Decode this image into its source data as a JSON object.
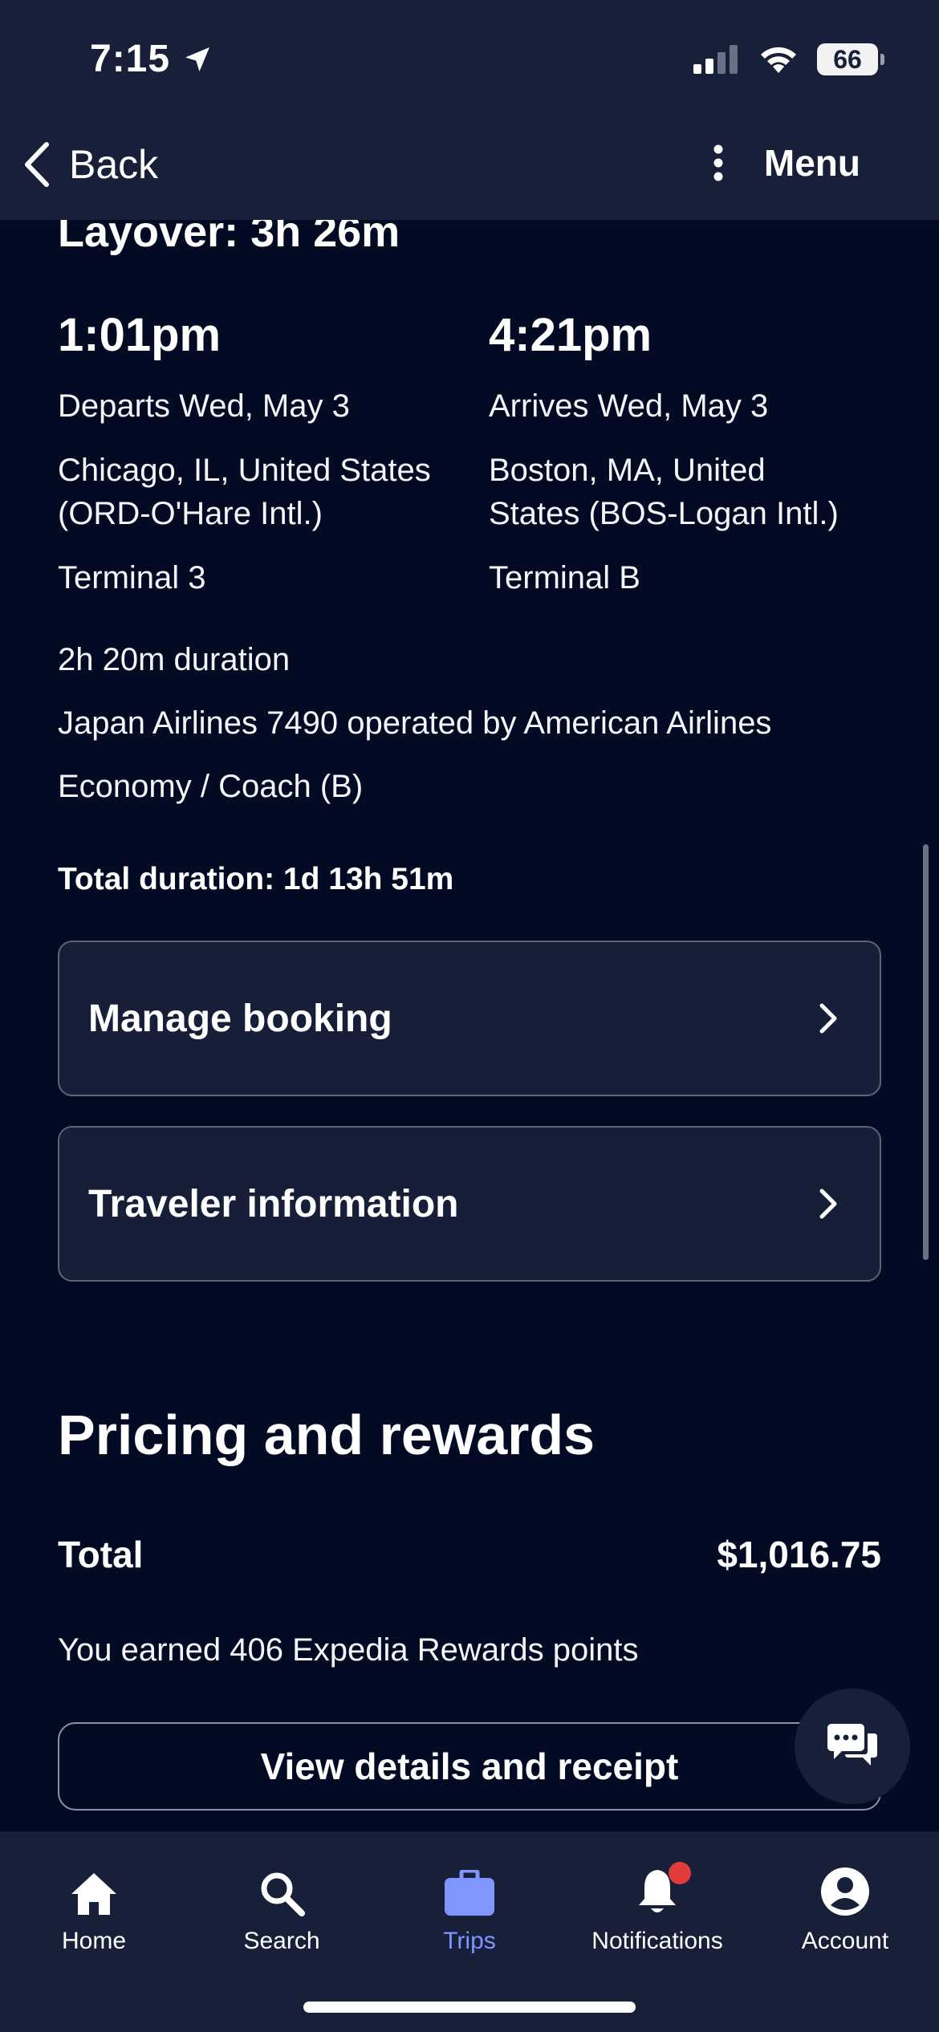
{
  "status_bar": {
    "time": "7:15",
    "battery": "66"
  },
  "nav": {
    "back_label": "Back",
    "menu_label": "Menu"
  },
  "flight": {
    "layover": "Layover: 3h 26m",
    "departure": {
      "time": "1:01pm",
      "date": "Departs Wed, May 3",
      "city_line1": "Chicago, IL, United States",
      "city_line2": "(ORD-O'Hare Intl.)",
      "terminal": "Terminal 3"
    },
    "arrival": {
      "time": "4:21pm",
      "date": "Arrives Wed, May 3",
      "city_line1": "Boston, MA, United",
      "city_line2": "States (BOS-Logan Intl.)",
      "terminal": "Terminal B"
    },
    "duration": "2h 20m duration",
    "carrier": "Japan Airlines 7490 operated by American Airlines",
    "cabin": "Economy / Coach (B)",
    "total_duration": "Total duration: 1d 13h 51m"
  },
  "actions": {
    "manage_booking": "Manage booking",
    "traveler_information": "Traveler information"
  },
  "pricing": {
    "title": "Pricing and rewards",
    "total_label": "Total",
    "total_value": "$1,016.75",
    "rewards_text": "You earned 406 Expedia Rewards points",
    "receipt_button": "View details and receipt"
  },
  "tabs": [
    {
      "label": "Home",
      "icon": "home-icon"
    },
    {
      "label": "Search",
      "icon": "search-icon"
    },
    {
      "label": "Trips",
      "icon": "briefcase-icon",
      "active": true
    },
    {
      "label": "Notifications",
      "icon": "bell-icon",
      "badge": true
    },
    {
      "label": "Account",
      "icon": "account-icon"
    }
  ],
  "colors": {
    "background": "#030b24",
    "bar": "#182039",
    "accent": "#7f95ff",
    "badge": "#e23b3b"
  }
}
